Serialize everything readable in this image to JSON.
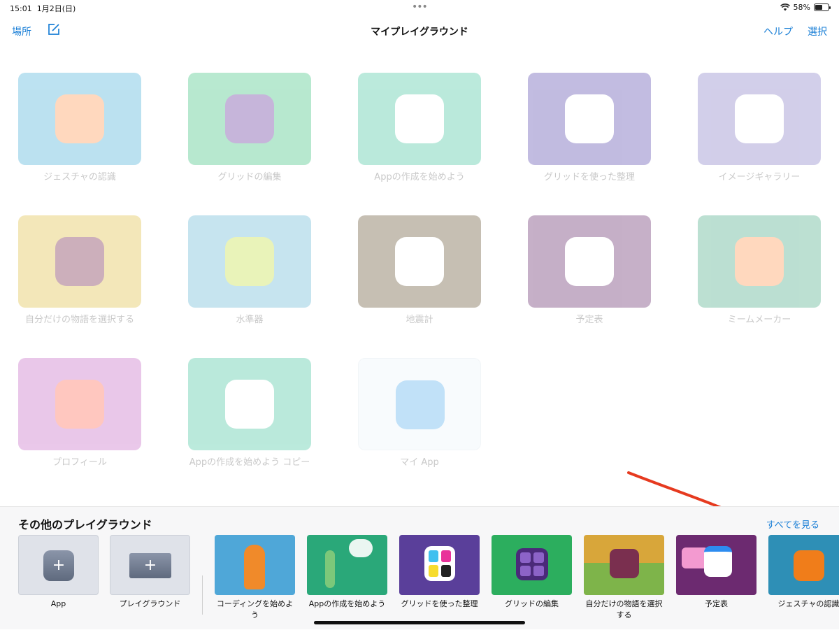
{
  "status": {
    "time": "15:01",
    "date": "1月2日(日)",
    "battery": "58%",
    "battery_fraction": 0.58,
    "wifi": "wifi-icon"
  },
  "nav": {
    "left_label": "場所",
    "title": "マイプレイグラウンド",
    "help": "ヘルプ",
    "select": "選択"
  },
  "grid": [
    {
      "label": "ジェスチャの認識",
      "bg": "#4fb3d9",
      "icon": "#ff9b57"
    },
    {
      "label": "グリッドの編集",
      "bg": "#45c483",
      "icon": "#6b3fa0"
    },
    {
      "label": "Appの作成を始めよう",
      "bg": "#4cc8a3",
      "icon": "#ffffff"
    },
    {
      "label": "グリッドを使った整理",
      "bg": "#5f4fb0",
      "icon": "#ffffff"
    },
    {
      "label": "イメージギャラリー",
      "bg": "#8a80c8",
      "icon": "#ffffff"
    },
    {
      "label": "自分だけの物語を選択する",
      "bg": "#e2c24a",
      "icon": "#7a2f4f"
    },
    {
      "label": "水準器",
      "bg": "#6bb9d6",
      "icon": "#c8e04a"
    },
    {
      "label": "地震計",
      "bg": "#6b5a3a",
      "icon": "#ffffff"
    },
    {
      "label": "予定表",
      "bg": "#6a2f6f",
      "icon": "#ffffff"
    },
    {
      "label": "ミームメーカー",
      "bg": "#4fae8a",
      "icon": "#ff9b57"
    },
    {
      "label": "プロフィール",
      "bg": "#c86fc8",
      "icon": "#ff6f5a"
    },
    {
      "label": "Appの作成を始めよう コピー",
      "bg": "#4cc8a3",
      "icon": "#ffffff"
    },
    {
      "label": "マイ App",
      "bg": "#eef5fb",
      "icon": "#5eb2ef"
    }
  ],
  "bottom": {
    "title": "その他のプレイグラウンド",
    "see_all": "すべてを見る",
    "new_items": [
      {
        "label": "App"
      },
      {
        "label": "プレイグラウンド"
      }
    ],
    "tiles": [
      {
        "label": "コーディングを始めよう",
        "bg": "#4fa7d8"
      },
      {
        "label": "Appの作成を始めよう",
        "bg": "#2aa879"
      },
      {
        "label": "グリッドを使った整理",
        "bg": "#5a3f9a"
      },
      {
        "label": "グリッドの編集",
        "bg": "#2cae5e"
      },
      {
        "label": "自分だけの物語を選択する",
        "bg": "#d8a63a"
      },
      {
        "label": "予定表",
        "bg": "#6c2a70"
      },
      {
        "label": "ジェスチャの認識",
        "bg": "#2e8fb6"
      }
    ]
  }
}
